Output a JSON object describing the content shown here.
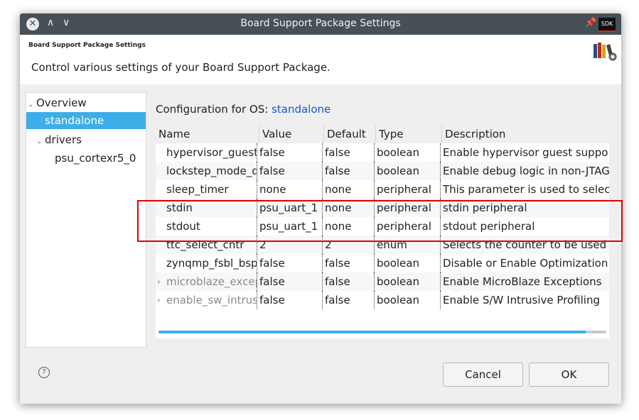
{
  "window": {
    "title": "Board Support Package Settings",
    "sdk_badge": "SDK"
  },
  "header": {
    "small_title": "Board Support Package Settings",
    "description": "Control various settings of your Board Support Package."
  },
  "nav": {
    "items": [
      {
        "label": "Overview",
        "chevron": "v"
      },
      {
        "label": "standalone"
      },
      {
        "label": "drivers",
        "chevron": "v"
      },
      {
        "label": "psu_cortexr5_0"
      }
    ]
  },
  "config": {
    "label": "Configuration for OS:",
    "os": "standalone"
  },
  "table": {
    "headers": [
      "Name",
      "Value",
      "Default",
      "Type",
      "Description"
    ],
    "rows": [
      {
        "name": "hypervisor_guest",
        "value": "false",
        "default": "false",
        "type": "boolean",
        "description": "Enable hypervisor guest suppo"
      },
      {
        "name": "lockstep_mode_de",
        "value": "false",
        "default": "false",
        "type": "boolean",
        "description": "Enable debug logic in non-JTAG"
      },
      {
        "name": "sleep_timer",
        "value": "none",
        "default": "none",
        "type": "peripheral",
        "description": "This parameter is used to selec"
      },
      {
        "name": "stdin",
        "value": "psu_uart_1",
        "default": "none",
        "type": "peripheral",
        "description": "stdin peripheral"
      },
      {
        "name": "stdout",
        "value": "psu_uart_1",
        "default": "none",
        "type": "peripheral",
        "description": "stdout peripheral"
      },
      {
        "name": "ttc_select_cntr",
        "value": "2",
        "default": "2",
        "type": "enum",
        "description": "Selects the counter to be used"
      },
      {
        "name": "zynqmp_fsbl_bsp",
        "value": "false",
        "default": "false",
        "type": "boolean",
        "description": "Disable or Enable Optimization"
      },
      {
        "name": "microblaze_excep",
        "value": "false",
        "default": "false",
        "type": "boolean",
        "description": "Enable MicroBlaze Exceptions"
      },
      {
        "name": "enable_sw_intrusi",
        "value": "false",
        "default": "false",
        "type": "boolean",
        "description": "Enable S/W Intrusive Profiling"
      }
    ]
  },
  "buttons": {
    "cancel": "Cancel",
    "ok": "OK"
  },
  "icons": {
    "close": "close-icon",
    "pin": "pin-icon",
    "help": "help-icon",
    "books": "books-gear-icon"
  }
}
